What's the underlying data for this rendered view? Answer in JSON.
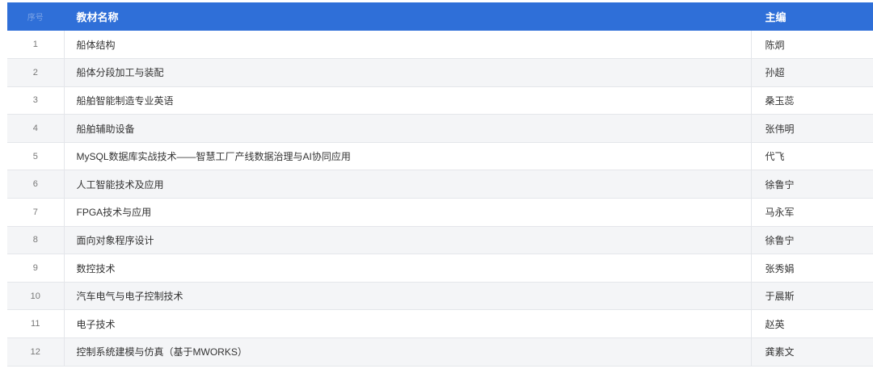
{
  "table": {
    "headers": {
      "index": "序号",
      "name": "教材名称",
      "editor": "主编"
    },
    "rows": [
      {
        "index": "1",
        "name": "船体结构",
        "editor": "陈炯"
      },
      {
        "index": "2",
        "name": "船体分段加工与装配",
        "editor": "孙超"
      },
      {
        "index": "3",
        "name": "船舶智能制造专业英语",
        "editor": "桑玉蕊"
      },
      {
        "index": "4",
        "name": "船舶辅助设备",
        "editor": "张伟明"
      },
      {
        "index": "5",
        "name": "MySQL数据库实战技术——智慧工厂产线数据治理与AI协同应用",
        "editor": "代飞"
      },
      {
        "index": "6",
        "name": "人工智能技术及应用",
        "editor": "徐鲁宁"
      },
      {
        "index": "7",
        "name": "FPGA技术与应用",
        "editor": "马永军"
      },
      {
        "index": "8",
        "name": "面向对象程序设计",
        "editor": "徐鲁宁"
      },
      {
        "index": "9",
        "name": "数控技术",
        "editor": "张秀娟"
      },
      {
        "index": "10",
        "name": "汽车电气与电子控制技术",
        "editor": "于晨斯"
      },
      {
        "index": "11",
        "name": "电子技术",
        "editor": "赵英"
      },
      {
        "index": "12",
        "name": "控制系统建模与仿真（基于MWORKS）",
        "editor": "龚素文"
      }
    ]
  },
  "colors": {
    "header_bg": "#2f6fd8",
    "header_text": "#ffffff",
    "stripe": "#f4f5f7"
  }
}
